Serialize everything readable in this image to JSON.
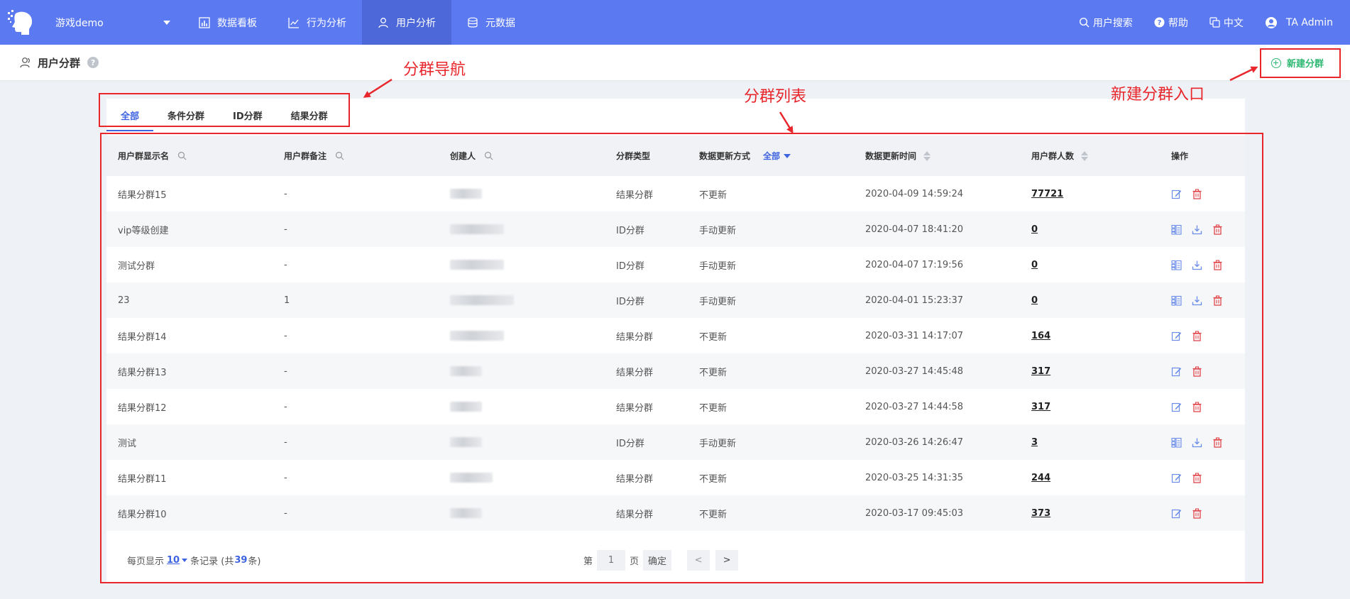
{
  "topnav": {
    "project": "游戏demo",
    "items": [
      {
        "label": "数据看板",
        "icon": "bar-chart-icon",
        "active": false
      },
      {
        "label": "行为分析",
        "icon": "line-chart-icon",
        "active": false
      },
      {
        "label": "用户分析",
        "icon": "user-icon",
        "active": true
      },
      {
        "label": "元数据",
        "icon": "database-icon",
        "active": false
      }
    ],
    "right": {
      "search": "用户搜索",
      "help": "帮助",
      "lang": "中文",
      "user": "TA Admin"
    },
    "brand_color": "#5b7af2"
  },
  "subhead": {
    "title": "用户分群",
    "help_mark": "?",
    "new_button": "新建分群"
  },
  "tabs": [
    "全部",
    "条件分群",
    "ID分群",
    "结果分群"
  ],
  "table": {
    "headers": {
      "name": "用户群显示名",
      "remark": "用户群备注",
      "creator": "创建人",
      "type": "分群类型",
      "update_mode": "数据更新方式",
      "update_filter": "全部",
      "update_time": "数据更新时间",
      "user_count": "用户群人数",
      "ops": "操作"
    },
    "rows": [
      {
        "name": "结果分群15",
        "remark": "-",
        "type": "结果分群",
        "mode": "不更新",
        "time": "2020-04-09 14:59:24",
        "count": "77721",
        "kind": "result"
      },
      {
        "name": "vip等级创建",
        "remark": "-",
        "type": "ID分群",
        "mode": "手动更新",
        "time": "2020-04-07 18:41:20",
        "count": "0",
        "kind": "id"
      },
      {
        "name": "测试分群",
        "remark": "-",
        "type": "ID分群",
        "mode": "手动更新",
        "time": "2020-04-07 17:19:56",
        "count": "0",
        "kind": "id"
      },
      {
        "name": "23",
        "remark": "1",
        "type": "ID分群",
        "mode": "手动更新",
        "time": "2020-04-01 15:23:37",
        "count": "0",
        "kind": "id"
      },
      {
        "name": "结果分群14",
        "remark": "-",
        "type": "结果分群",
        "mode": "不更新",
        "time": "2020-03-31 14:17:07",
        "count": "164",
        "kind": "result"
      },
      {
        "name": "结果分群13",
        "remark": "-",
        "type": "结果分群",
        "mode": "不更新",
        "time": "2020-03-27 14:45:48",
        "count": "317",
        "kind": "result"
      },
      {
        "name": "结果分群12",
        "remark": "-",
        "type": "结果分群",
        "mode": "不更新",
        "time": "2020-03-27 14:44:58",
        "count": "317",
        "kind": "result"
      },
      {
        "name": "测试",
        "remark": "-",
        "type": "ID分群",
        "mode": "手动更新",
        "time": "2020-03-26 14:26:47",
        "count": "3",
        "kind": "id"
      },
      {
        "name": "结果分群11",
        "remark": "-",
        "type": "结果分群",
        "mode": "不更新",
        "time": "2020-03-25 14:31:35",
        "count": "244",
        "kind": "result"
      },
      {
        "name": "结果分群10",
        "remark": "-",
        "type": "结果分群",
        "mode": "不更新",
        "time": "2020-03-17 09:45:03",
        "count": "373",
        "kind": "result"
      }
    ]
  },
  "pagination": {
    "per_page_prefix": "每页显示",
    "per_page": "10",
    "per_page_suffix": "条记录 (共",
    "total": "39",
    "total_suffix": "条)",
    "page_prefix": "第",
    "page": "1",
    "page_suffix": "页",
    "confirm": "确定",
    "prev": "<",
    "next": ">"
  },
  "annotations": {
    "nav": "分群导航",
    "list": "分群列表",
    "entry": "新建分群入口",
    "color": "#e8262b"
  }
}
